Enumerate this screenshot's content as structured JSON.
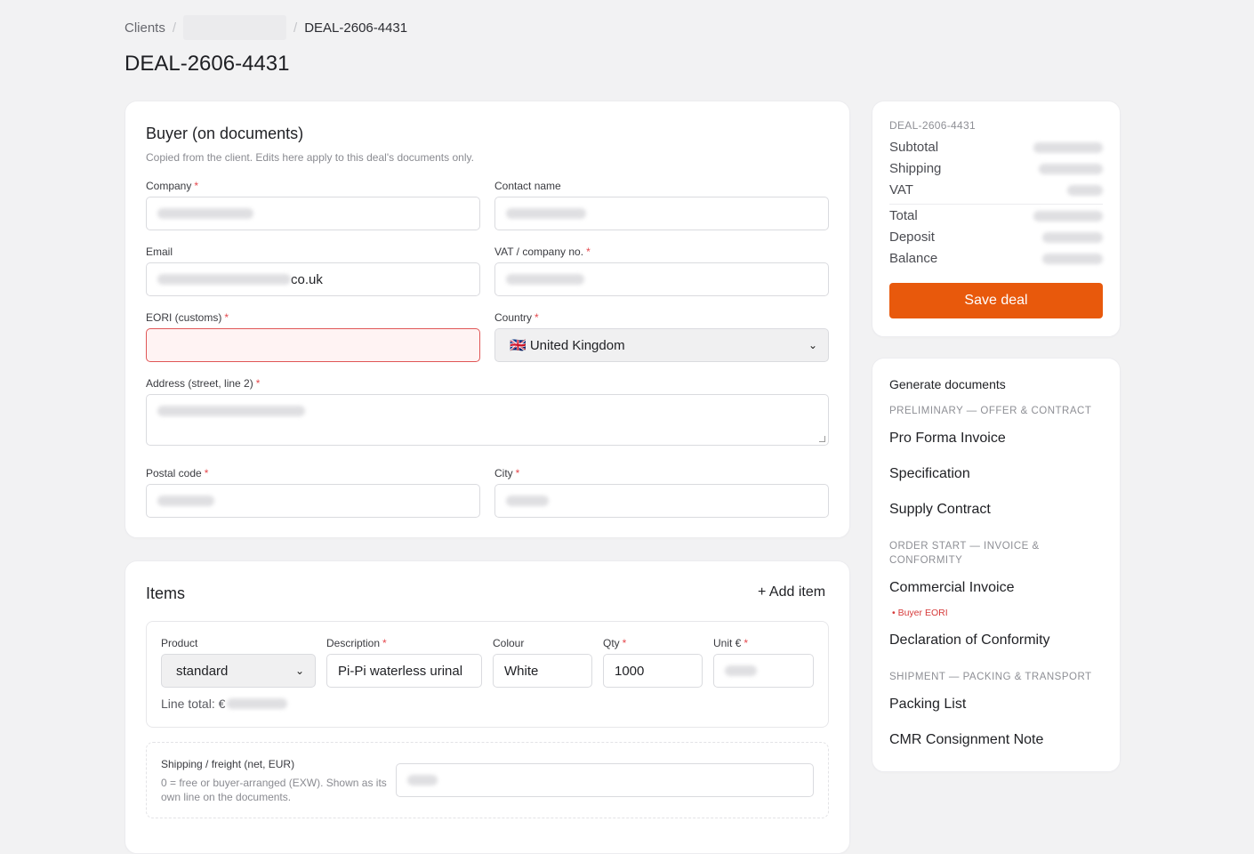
{
  "breadcrumb": {
    "root": "Clients",
    "separator": "/",
    "current": "DEAL-2606-4431"
  },
  "page_title": "DEAL-2606-4431",
  "buyer": {
    "title": "Buyer (on documents)",
    "hint": "Copied from the client. Edits here apply to this deal's documents only.",
    "company_label": "Company",
    "contact_label": "Contact name",
    "email_label": "Email",
    "email_suffix": "co.uk",
    "vat_label": "VAT / company no.",
    "eori_label": "EORI (customs)",
    "country_label": "Country",
    "country_value": "🇬🇧 United Kingdom",
    "address_label": "Address (street, line 2)",
    "postal_label": "Postal code",
    "city_label": "City",
    "required_mark": "*"
  },
  "items": {
    "title": "Items",
    "add_label": "+ Add item",
    "product_label": "Product",
    "product_value": "standard",
    "description_label": "Description",
    "description_value": "Pi-Pi waterless urinal",
    "colour_label": "Colour",
    "colour_value": "White",
    "qty_label": "Qty",
    "qty_value": "1000",
    "unit_label": "Unit €",
    "line_total_label": "Line total: €",
    "shipping_label": "Shipping / freight (net, EUR)",
    "shipping_hint": "0 = free or buyer-arranged (EXW). Shown as its own line on the documents."
  },
  "summary": {
    "deal_id": "DEAL-2606-4431",
    "rows": [
      "Subtotal",
      "Shipping",
      "VAT",
      "Total",
      "Deposit",
      "Balance"
    ],
    "save_label": "Save deal"
  },
  "documents": {
    "title": "Generate documents",
    "group1": "PRELIMINARY — OFFER & CONTRACT",
    "doc1": "Pro Forma Invoice",
    "doc2": "Specification",
    "doc3": "Supply Contract",
    "group2": "ORDER START — INVOICE & CONFORMITY",
    "doc4": "Commercial Invoice",
    "doc4_note": "• Buyer EORI",
    "doc5": "Declaration of Conformity",
    "group3": "SHIPMENT — PACKING & TRANSPORT",
    "doc6": "Packing List",
    "doc7": "CMR Consignment Note"
  },
  "colors": {
    "accent": "#e8590c",
    "error": "#e5484d",
    "background": "#f2f2f3"
  }
}
